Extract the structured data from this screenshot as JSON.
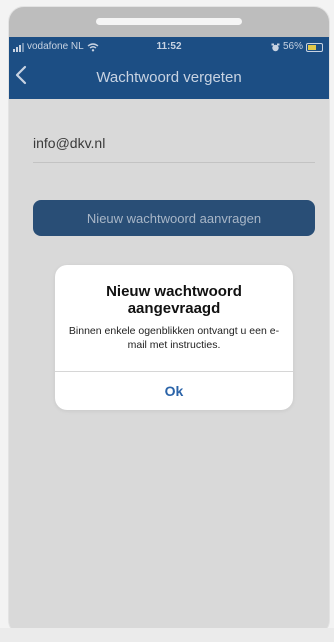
{
  "status": {
    "carrier": "vodafone NL",
    "time": "11:52",
    "battery": "56%",
    "battery_level": 0.56
  },
  "nav": {
    "back_icon": "chevron-left-icon",
    "title": "Wachtwoord vergeten"
  },
  "form": {
    "email": "info@dkv.nl",
    "button": "Nieuw wachtwoord aanvragen"
  },
  "dialog": {
    "title": "Nieuw wachtwoord aangevraagd",
    "message": "Binnen enkele ogenblikken ontvangt u een e-mail met instructies.",
    "ok": "Ok"
  },
  "colors": {
    "nav_bg": "#1c4e84",
    "button_bg": "#294e76",
    "ok_text": "#2a63a8",
    "overlay_bg": "#d9d9d9"
  }
}
